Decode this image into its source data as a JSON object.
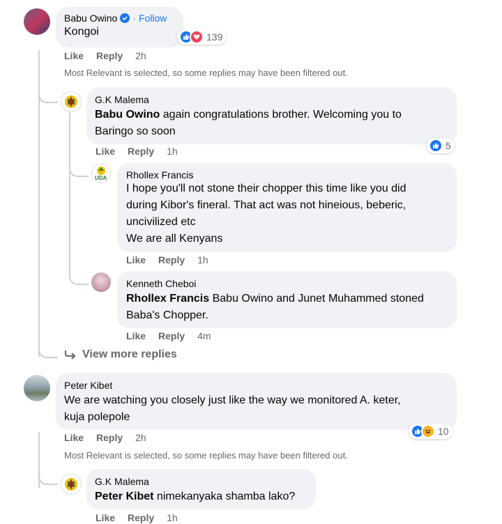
{
  "comments": [
    {
      "author": "Babu Owino",
      "verified": true,
      "follow_label": "Follow",
      "text": "Kongoi",
      "reaction_count": "139",
      "like": "Like",
      "reply": "Reply",
      "time": "2h",
      "notice": "Most Relevant is selected, so some replies may have been filtered out."
    },
    {
      "author": "G.K Malema",
      "mention": "Babu Owino",
      "text_line1": " again congratulations brother. Welcoming you to",
      "text_line2": "Baringo so soon",
      "reaction_count": "5",
      "like": "Like",
      "reply": "Reply",
      "time": "1h"
    },
    {
      "author": "Rhollex Francis",
      "avatar_label": "UDA",
      "lines": [
        "I hope you'll not stone their chopper this time like you did",
        "during Kibor's fineral. That act was not hineious, beberic,",
        "uncivilized etc",
        "We are all Kenyans"
      ],
      "like": "Like",
      "reply": "Reply",
      "time": "1h"
    },
    {
      "author": "Kenneth Cheboi",
      "mention": "Rhollex Francis",
      "text_line1": " Babu Owino and Junet Muhammed stoned",
      "text_line2": "Baba's Chopper.",
      "like": "Like",
      "reply": "Reply",
      "time": "4m"
    },
    {
      "view_more": "View more replies"
    },
    {
      "author": "Peter Kibet",
      "text_line1": "We are watching you closely just like the way we monitored A. keter,",
      "text_line2": "kuja polepole",
      "reaction_count": "10",
      "like": "Like",
      "reply": "Reply",
      "time": "2h",
      "notice": "Most Relevant is selected, so some replies may have been filtered out."
    },
    {
      "author": "G.K Malema",
      "mention": "Peter Kibet",
      "text_line1": " nimekanyaka shamba lako?",
      "like": "Like",
      "reply": "Reply",
      "time": "1h"
    }
  ],
  "colors": {
    "bubble": "#f0f2f5",
    "meta": "#65676b",
    "link": "#1877f2",
    "thread_line": "#ccd0d5",
    "like_blue": "#1877f2",
    "love_red": "#f33e58",
    "haha_yellow": "#f7b125"
  },
  "icons": [
    "verified-badge-icon",
    "like-reaction-icon",
    "love-reaction-icon",
    "haha-reaction-icon",
    "reply-arrow-icon"
  ]
}
